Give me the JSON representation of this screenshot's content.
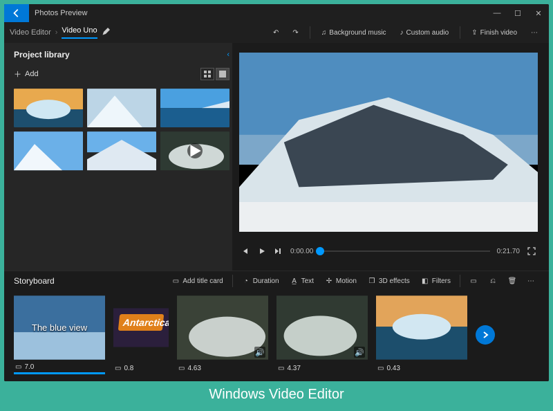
{
  "window": {
    "title": "Photos Preview",
    "minimize": "—",
    "maximize": "☐",
    "close": "✕"
  },
  "breadcrumb": {
    "root": "Video Editor",
    "current": "Video Uno"
  },
  "toolbar": {
    "undo": "↶",
    "redo": "↷",
    "bg_music": "Background music",
    "custom_audio": "Custom audio",
    "finish": "Finish video",
    "more": "⋯"
  },
  "library": {
    "title": "Project library",
    "add": "Add"
  },
  "transport": {
    "current_time": "0:00.00",
    "total_time": "0:21.70"
  },
  "storyboard": {
    "title": "Storyboard",
    "add_title_card": "Add title card",
    "duration": "Duration",
    "text": "Text",
    "motion": "Motion",
    "effects": "3D effects",
    "filters": "Filters"
  },
  "clips": [
    {
      "label": "7.0",
      "overlay": "The blue view",
      "type": "image"
    },
    {
      "label": "0.8",
      "overlay": "Antarctica",
      "type": "image"
    },
    {
      "label": "4.63",
      "overlay": "",
      "type": "video"
    },
    {
      "label": "4.37",
      "overlay": "",
      "type": "video"
    },
    {
      "label": "0.43",
      "overlay": "",
      "type": "image"
    }
  ],
  "caption": "Windows Video Editor"
}
